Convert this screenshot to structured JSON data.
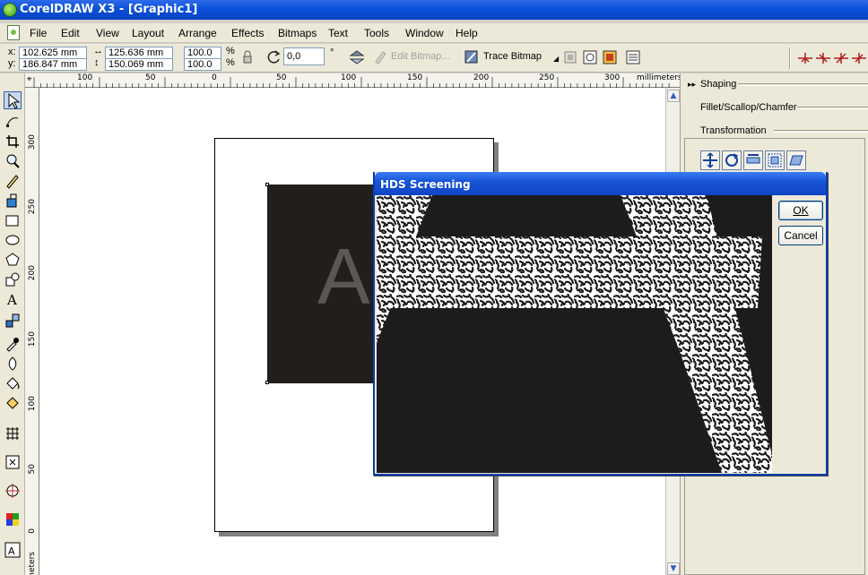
{
  "app": {
    "title": "CorelDRAW X3 - [Graphic1]"
  },
  "menu": {
    "items": [
      "File",
      "Edit",
      "View",
      "Layout",
      "Arrange",
      "Effects",
      "Bitmaps",
      "Text",
      "Tools",
      "Window",
      "Help"
    ]
  },
  "property_bar": {
    "x_label": "x:",
    "y_label": "y:",
    "x_value": "102.625 mm",
    "y_value": "186.847 mm",
    "width_value": "125.636 mm",
    "height_value": "150.069 mm",
    "scale_x": "100.0",
    "scale_y": "100.0",
    "percent": "%",
    "rotation_value": "0,0",
    "degree": "°",
    "edit_bitmap_label": "Edit Bitmap...",
    "trace_bitmap_label": "Trace Bitmap"
  },
  "ruler": {
    "units": "millimeters",
    "h_ticks": [
      "100",
      "50",
      "0",
      "50",
      "100",
      "150",
      "200",
      "250",
      "300"
    ],
    "v_ticks": [
      "300",
      "250",
      "200",
      "150",
      "100",
      "50",
      "0"
    ],
    "v_units_partial": "neters"
  },
  "canvas": {
    "letter": "A"
  },
  "docker": {
    "shaping": "Shaping",
    "fillet": "Fillet/Scallop/Chamfer",
    "transformation": "Transformation"
  },
  "dialog": {
    "title": "HDS Screening",
    "ok_label": "OK",
    "cancel_label": "Cancel"
  },
  "colors": {
    "title_blue": "#0a50d8",
    "chrome": "#ece9d8",
    "dark_rect": "#221e1b",
    "preview_bg": "#1c1c1c"
  }
}
